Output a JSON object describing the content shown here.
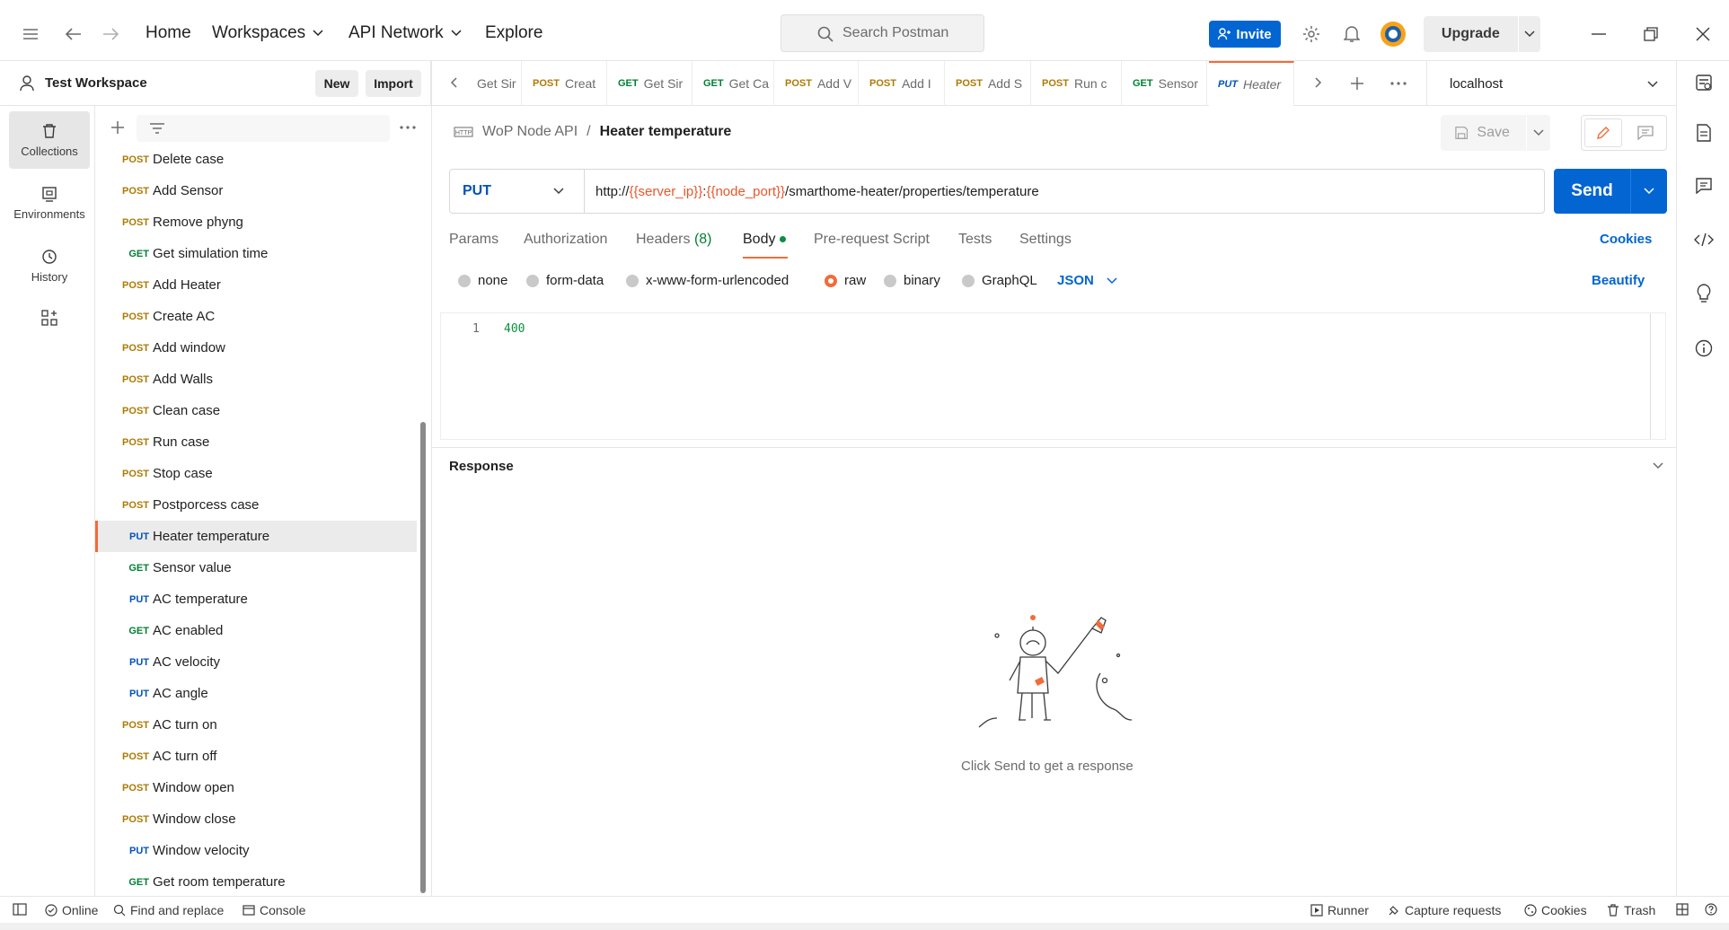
{
  "nav": {
    "home": "Home",
    "workspaces": "Workspaces",
    "api_network": "API Network",
    "explore": "Explore",
    "search_placeholder": "Search Postman",
    "invite": "Invite",
    "upgrade": "Upgrade"
  },
  "workspace": {
    "name": "Test Workspace",
    "new_label": "New",
    "import_label": "Import"
  },
  "rail": {
    "collections": "Collections",
    "environments": "Environments",
    "history": "History"
  },
  "tree": {
    "items": [
      {
        "method": "POST",
        "name": "Delete case"
      },
      {
        "method": "POST",
        "name": "Add Sensor"
      },
      {
        "method": "POST",
        "name": "Remove phyng"
      },
      {
        "method": "GET",
        "name": "Get simulation time"
      },
      {
        "method": "POST",
        "name": "Add Heater"
      },
      {
        "method": "POST",
        "name": "Create AC"
      },
      {
        "method": "POST",
        "name": "Add window"
      },
      {
        "method": "POST",
        "name": "Add Walls"
      },
      {
        "method": "POST",
        "name": "Clean case"
      },
      {
        "method": "POST",
        "name": "Run case"
      },
      {
        "method": "POST",
        "name": "Stop case"
      },
      {
        "method": "POST",
        "name": "Postporcess case"
      },
      {
        "method": "PUT",
        "name": "Heater temperature",
        "selected": true
      },
      {
        "method": "GET",
        "name": "Sensor value"
      },
      {
        "method": "PUT",
        "name": "AC temperature"
      },
      {
        "method": "GET",
        "name": "AC enabled"
      },
      {
        "method": "PUT",
        "name": "AC velocity"
      },
      {
        "method": "PUT",
        "name": "AC angle"
      },
      {
        "method": "POST",
        "name": "AC turn on"
      },
      {
        "method": "POST",
        "name": "AC turn off"
      },
      {
        "method": "POST",
        "name": "Window open"
      },
      {
        "method": "POST",
        "name": "Window close"
      },
      {
        "method": "PUT",
        "name": "Window velocity"
      },
      {
        "method": "GET",
        "name": "Get room temperature"
      }
    ]
  },
  "tabs": [
    {
      "method": "",
      "name": "Get Sir"
    },
    {
      "method": "POST",
      "name": "Creat"
    },
    {
      "method": "GET",
      "name": "Get Sir"
    },
    {
      "method": "GET",
      "name": "Get Ca"
    },
    {
      "method": "POST",
      "name": "Add V"
    },
    {
      "method": "POST",
      "name": "Add I"
    },
    {
      "method": "POST",
      "name": "Add S"
    },
    {
      "method": "POST",
      "name": "Run c"
    },
    {
      "method": "GET",
      "name": "Sensor"
    },
    {
      "method": "PUT",
      "name": "Heater",
      "active": true
    }
  ],
  "environment": "localhost",
  "request": {
    "collection": "WoP Node API",
    "separator": "/",
    "name": "Heater temperature",
    "save": "Save",
    "method": "PUT",
    "url_prefix": "http://",
    "var_server": "{{server_ip}}",
    "colon": ":",
    "var_port": "{{node_port}}",
    "url_path": "/smarthome-heater/properties/temperature",
    "send": "Send",
    "cookies": "Cookies",
    "beautify": "Beautify"
  },
  "request_tabs": {
    "params": "Params",
    "authorization": "Authorization",
    "headers": "Headers",
    "headers_count": "(8)",
    "body": "Body",
    "prerequest": "Pre-request Script",
    "tests": "Tests",
    "settings": "Settings"
  },
  "body_types": {
    "none": "none",
    "form_data": "form-data",
    "urlencoded": "x-www-form-urlencoded",
    "raw": "raw",
    "binary": "binary",
    "graphql": "GraphQL",
    "format": "JSON"
  },
  "editor": {
    "line_number": "1",
    "content": "400"
  },
  "response": {
    "title": "Response",
    "empty_message": "Click Send to get a response"
  },
  "status": {
    "online": "Online",
    "find_replace": "Find and replace",
    "console": "Console",
    "runner": "Runner",
    "capture": "Capture requests",
    "cookies": "Cookies",
    "trash": "Trash"
  },
  "colors": {
    "accent": "#f26b3a",
    "primary": "#0265d2",
    "post": "#ad7a03",
    "get": "#007f31",
    "put": "#0053b8"
  }
}
